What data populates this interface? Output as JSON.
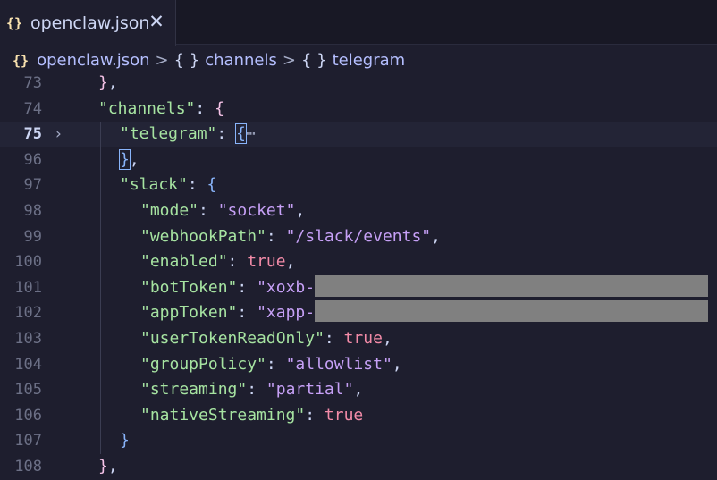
{
  "tab": {
    "icon": "{}",
    "filename": "openclaw.json",
    "close_glyph": "✕"
  },
  "breadcrumb": {
    "file_icon": "{}",
    "file": "openclaw.json",
    "sep": ">",
    "obj_icon": "{ }",
    "item1": "channels",
    "item2": "telegram"
  },
  "lines": [
    {
      "n": "73",
      "code": "},"
    },
    {
      "n": "74",
      "code": "\"channels\": {"
    },
    {
      "n": "75",
      "code": "\"telegram\": {⋯"
    },
    {
      "n": "96",
      "code": "},"
    },
    {
      "n": "97",
      "code": "\"slack\": {"
    },
    {
      "n": "98",
      "code": "\"mode\": \"socket\","
    },
    {
      "n": "99",
      "code": "\"webhookPath\": \"/slack/events\","
    },
    {
      "n": "100",
      "code": "\"enabled\": true,"
    },
    {
      "n": "101",
      "code": "\"botToken\": \"xoxb-"
    },
    {
      "n": "102",
      "code": "\"appToken\": \"xapp-"
    },
    {
      "n": "103",
      "code": "\"userTokenReadOnly\": true,"
    },
    {
      "n": "104",
      "code": "\"groupPolicy\": \"allowlist\","
    },
    {
      "n": "105",
      "code": "\"streaming\": \"partial\","
    },
    {
      "n": "106",
      "code": "\"nativeStreaming\": true"
    },
    {
      "n": "107",
      "code": "}"
    },
    {
      "n": "108",
      "code": "},"
    }
  ],
  "tokens": {
    "k_channels": "\"channels\"",
    "k_telegram": "\"telegram\"",
    "k_slack": "\"slack\"",
    "k_mode": "\"mode\"",
    "v_mode": "\"socket\"",
    "k_webhook": "\"webhookPath\"",
    "v_webhook": "\"/slack/events\"",
    "k_enabled": "\"enabled\"",
    "v_true": "true",
    "k_bot": "\"botToken\"",
    "v_bot_prefix": "\"xoxb-",
    "k_app": "\"appToken\"",
    "v_app_prefix": "\"xapp-",
    "k_userro": "\"userTokenReadOnly\"",
    "k_group": "\"groupPolicy\"",
    "v_group": "\"allowlist\"",
    "k_stream": "\"streaming\"",
    "v_stream": "\"partial\"",
    "k_native": "\"nativeStreaming\"",
    "ellipsis": "⋯",
    "colon": ": ",
    "comma": ",",
    "open": "{",
    "close": "}"
  },
  "current_line": "75",
  "fold_glyph": "›",
  "colors": {
    "background": "#1e1e2e",
    "key": "#a6e3a1",
    "string": "#c6a0f6",
    "boolean": "#f38ba8",
    "redaction": "#808080"
  }
}
